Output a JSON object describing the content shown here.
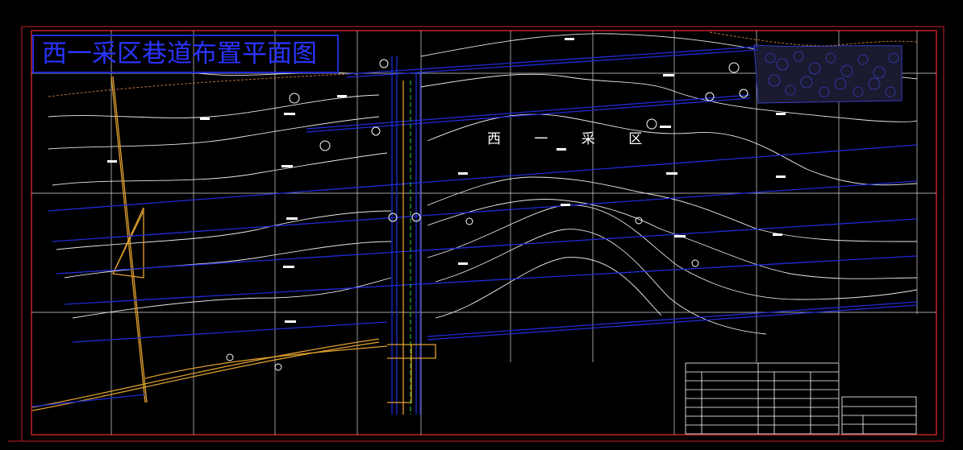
{
  "drawing": {
    "title": "西一采区巷道布置平面图",
    "area_label": "西 一 采 区"
  },
  "colors": {
    "background": "#000000",
    "frame": "#c8202a",
    "grid": "#ffffff",
    "contour": "#ffffff",
    "roadway": "#1f2bd6",
    "boundary": "#e0a030",
    "shaft_green": "#1fa83a"
  },
  "legend": {
    "title_block_present": true
  }
}
